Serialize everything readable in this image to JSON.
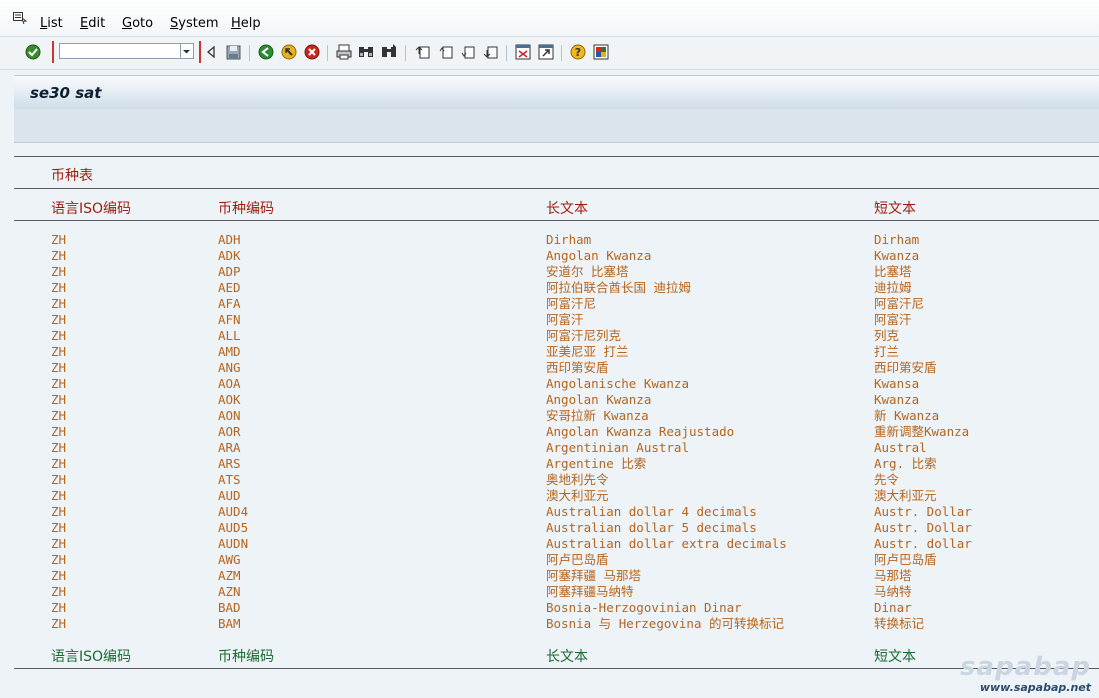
{
  "menu": {
    "items": [
      {
        "label": "List",
        "key": "L",
        "rest": "ist"
      },
      {
        "label": "Edit",
        "key": "E",
        "rest": "dit"
      },
      {
        "label": "Goto",
        "key": "G",
        "rest": "oto"
      },
      {
        "label": "System",
        "key": "S",
        "rest": "ystem"
      },
      {
        "label": "Help",
        "key": "H",
        "rest": "elp"
      }
    ]
  },
  "toolbar": {
    "command_value": "",
    "icons": [
      "enter-icon",
      "back-arrow-icon",
      "save-icon",
      "back-icon",
      "exit-icon",
      "cancel-icon",
      "print-icon",
      "find-icon",
      "find-next-icon",
      "first-page-icon",
      "previous-page-icon",
      "next-page-icon",
      "last-page-icon",
      "create-session-icon",
      "shortcut-icon",
      "help-icon",
      "layout-icon"
    ]
  },
  "title": "se30 sat",
  "list": {
    "heading": "币种表",
    "columns": [
      "语言ISO编码",
      "币种编码",
      "长文本",
      "短文本"
    ],
    "rows": [
      [
        "ZH",
        "ADH",
        "Dirham",
        "Dirham"
      ],
      [
        "ZH",
        "ADK",
        "Angolan Kwanza",
        "Kwanza"
      ],
      [
        "ZH",
        "ADP",
        "安道尔 比塞塔",
        "比塞塔"
      ],
      [
        "ZH",
        "AED",
        "阿拉伯联合酋长国 迪拉姆",
        "迪拉姆"
      ],
      [
        "ZH",
        "AFA",
        "阿富汗尼",
        "阿富汗尼"
      ],
      [
        "ZH",
        "AFN",
        "阿富汗",
        "阿富汗"
      ],
      [
        "ZH",
        "ALL",
        "阿富汗尼列克",
        "列克"
      ],
      [
        "ZH",
        "AMD",
        "亚美尼亚 打兰",
        "打兰"
      ],
      [
        "ZH",
        "ANG",
        "西印第安盾",
        "西印第安盾"
      ],
      [
        "ZH",
        "AOA",
        "Angolanische Kwanza",
        "Kwansa"
      ],
      [
        "ZH",
        "AOK",
        "Angolan Kwanza",
        "Kwanza"
      ],
      [
        "ZH",
        "AON",
        "安哥拉新 Kwanza",
        "新 Kwanza"
      ],
      [
        "ZH",
        "AOR",
        "Angolan Kwanza Reajustado",
        "重新调整Kwanza"
      ],
      [
        "ZH",
        "ARA",
        "Argentinian Austral",
        "Austral"
      ],
      [
        "ZH",
        "ARS",
        "Argentine 比索",
        "Arg. 比索"
      ],
      [
        "ZH",
        "ATS",
        "奥地利先令",
        "先令"
      ],
      [
        "ZH",
        "AUD",
        "澳大利亚元",
        "澳大利亚元"
      ],
      [
        "ZH",
        "AUD4",
        "Australian dollar 4 decimals",
        "Austr. Dollar"
      ],
      [
        "ZH",
        "AUD5",
        "Australian dollar 5 decimals",
        "Austr. Dollar"
      ],
      [
        "ZH",
        "AUDN",
        "Australian dollar extra decimals",
        "Austr. dollar"
      ],
      [
        "ZH",
        "AWG",
        "阿卢巴岛盾",
        "阿卢巴岛盾"
      ],
      [
        "ZH",
        "AZM",
        "阿塞拜疆 马那塔",
        "马那塔"
      ],
      [
        "ZH",
        "AZN",
        "阿塞拜疆马纳特",
        "马纳特"
      ],
      [
        "ZH",
        "BAD",
        "Bosnia-Herzogovinian Dinar",
        "Dinar"
      ],
      [
        "ZH",
        "BAM",
        "Bosnia 与 Herzegovina 的可转换标记",
        "转换标记"
      ]
    ],
    "footer_columns": [
      "语言ISO编码",
      "币种编码",
      "长文本",
      "短文本"
    ]
  },
  "watermark": {
    "brand": "sapabap",
    "url": "www.sapabap.net"
  },
  "colors": {
    "header_red": "#9a1f10",
    "footer_green": "#1a6b32",
    "row_text": "#b5651d"
  }
}
